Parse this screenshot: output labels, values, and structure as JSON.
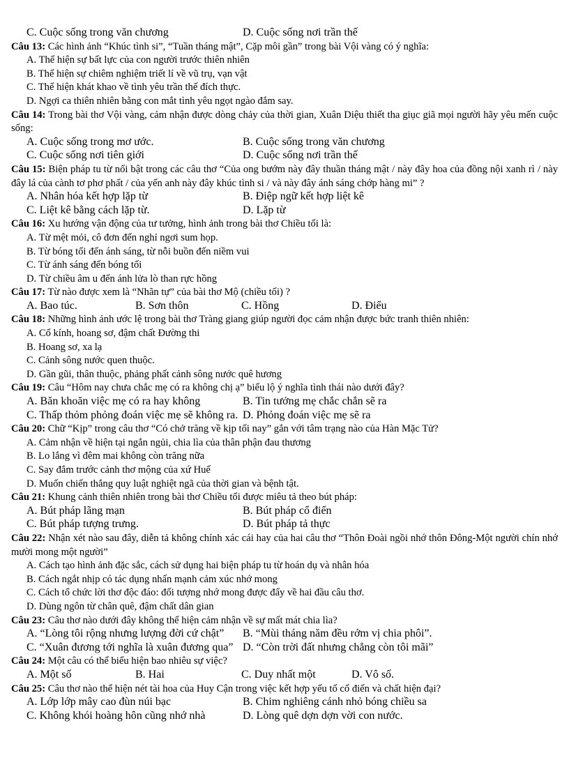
{
  "document": {
    "type": "multiple-choice-exam",
    "language": "vi",
    "subject_hint": "Ngữ văn"
  },
  "orphan_line": {
    "option_c": "C. Cuộc sống trong văn chương",
    "option_d": "D. Cuộc sống nơi trần thế"
  },
  "questions": [
    {
      "id": "cau-13",
      "number": "Câu 13:",
      "stem": " Các hình ảnh “Khúc tình si”, “Tuần tháng mật”, Cặp môi gần” trong bài Vội vàng có ý nghĩa:",
      "layout": "single",
      "options": [
        "A. Thể hiện sự bất lực của con người trước thiên nhiên",
        "B. Thể hiện sự chiêm nghiệm  triết lí về vũ trụ, vạn vật",
        "C. Thể hiện khát khao về tình yêu trần thế đích thực.",
        "D. Ngợi ca thiên nhiên bằng con mắt tình yêu ngọt ngào đắm say."
      ]
    },
    {
      "id": "cau-14",
      "number": "Câu 14:",
      "stem": " Trong bài thơ Vội vàng, cảm nhận được dòng chảy của thời gian, Xuân Diệu thiết tha giục giã mọi người hãy yêu mến cuộc sống:",
      "layout": "two-col",
      "options": [
        "A. Cuộc sống trong mơ ước.",
        "B. Cuộc sống trong văn chương",
        "C. Cuộc sống nơi tiên giới",
        "D. Cuộc sống nơi trần thế"
      ]
    },
    {
      "id": "cau-15",
      "number": "Câu 15:",
      "stem": " Biện pháp tu từ nổi bật trong các câu thơ “Của ong bướm này đây thuần tháng mật / này đây hoa của đồng nội xanh rì / này đây lá của cành tơ phơ phất / của yến anh này đây khúc tình si / và này đây ánh sáng chớp hàng mi” ?",
      "layout": "two-col",
      "options": [
        "A. Nhân hóa kết hợp lặp từ",
        "B. Điệp ngữ kết hợp liệt kê",
        "C. Liệt kê bằng cách lặp từ.",
        "D. Lặp từ"
      ]
    },
    {
      "id": "cau-16",
      "number": "Câu 16:",
      "stem": " Xu hướng vận động của tư tưởng, hình ảnh trong bài thơ Chiều tối là:",
      "layout": "single",
      "options": [
        "A. Từ mệt mỏi, cô đơn đến nghỉ ngơi sum họp.",
        "B. Từ bóng tối đến ánh sáng, từ nỗi buồn đến niềm vui",
        "C. Từ ánh sáng đến bóng tối",
        "D. Từ chiều âm u đến ánh lửa lò than rực hồng"
      ]
    },
    {
      "id": "cau-17",
      "number": "Câu 17:",
      "stem": " Từ nào được xem là “Nhãn tự” của bài thơ Mộ (chiều tối) ?",
      "layout": "four-col",
      "options": [
        "A. Bao túc.",
        "B. Sơn thôn",
        "C. Hồng",
        "D. Điểu"
      ]
    },
    {
      "id": "cau-18",
      "number": "Câu 18:",
      "stem": " Những hình ảnh ước lệ trong bài thơ Tràng giang giúp người đọc cảm nhận được bức tranh thiên nhiên:",
      "layout": "single",
      "options": [
        "A. Cổ kính, hoang sơ, đậm chất Đường thi",
        "B. Hoang sơ, xa lạ",
        "C. Cảnh sông nước quen thuộc.",
        "D. Gần gũi, thân thuộc, phảng phất cảnh sông nước quê hương"
      ]
    },
    {
      "id": "cau-19",
      "number": "Câu 19:",
      "stem": " Câu “Hôm nay chưa chắc mẹ có ra không chị ạ” biểu lộ ý nghĩa tình thái nào dưới đây?",
      "layout": "two-col",
      "options": [
        "A. Băn khoăn việc mẹ có ra hay không",
        "B. Tin tưởng mẹ chắc chắn sẽ ra",
        "C. Thấp thỏm phỏng đoán việc mẹ sẽ không ra.",
        "D. Phỏng đoán việc mẹ sẽ ra"
      ]
    },
    {
      "id": "cau-20",
      "number": "Câu 20:",
      "stem": " Chữ “Kịp” trong câu thơ “Có chở trăng về kịp tối nay” gắn với tâm trạng nào của Hàn Mặc Tử?",
      "layout": "single",
      "options": [
        "A. Cảm nhận về hiện tại ngắn ngủi, chia lìa của thân phận đau thương",
        "B. Lo lắng vì đêm mai không còn trăng nữa",
        "C. Say đắm trước cảnh thơ mộng của xứ Huế",
        "D. Muốn chiến thắng quy luật nghiệt ngã của thời gian và bệnh tật."
      ]
    },
    {
      "id": "cau-21",
      "number": "Câu 21:",
      "stem": " Khung cảnh thiên nhiên trong bài thơ Chiều tối được miêu tả theo bút pháp:",
      "layout": "two-col",
      "options": [
        "A. Bút pháp lãng mạn",
        "B. Bút pháp cổ điển",
        "C. Bút pháp tượng trưng.",
        "D. Bút pháp tả thực"
      ]
    },
    {
      "id": "cau-22",
      "number": "Câu 22:",
      "stem": " Nhận xét nào sau đây, diễn tả không chính xác cái hay của hai câu thơ “Thôn Đoài ngồi nhớ thôn Đông-Một người chín nhớ mười mong một người”",
      "layout": "single",
      "options": [
        "A. Cách tạo hình ảnh đặc sắc, cách sử dụng hai biện pháp tu từ hoán dụ và nhân hóa",
        "B. Cách ngắt nhịp có tác dụng nhấn mạnh cảm xúc nhớ mong",
        "C. Cách tổ chức lời thơ độc đáo: đối tượng nhớ mong được đẩy về hai đầu câu thơ.",
        "D. Dùng ngôn từ chân quê, đậm chất dân gian"
      ]
    },
    {
      "id": "cau-23",
      "number": "Câu 23:",
      "stem": " Câu thơ nào dưới đây không thể hiện cảm nhận về sự mất mát chia lìa?",
      "layout": "two-col",
      "options": [
        "A. “Lòng tôi rộng nhưng lượng đời cứ chật”",
        "B. “Mùi tháng năm đều rớm vị chia phôi”.",
        "C. “Xuân đương tới nghĩa là xuân đương qua”",
        "D. “Còn trời đất nhưng chẳng còn tôi mãi”"
      ]
    },
    {
      "id": "cau-24",
      "number": "Câu 24:",
      "stem": " Một câu có thể biểu hiện bao nhiêu sự việc?",
      "layout": "four-col",
      "options": [
        "A. Một số",
        "B. Hai",
        "C. Duy nhất một",
        "D. Vô số."
      ]
    },
    {
      "id": "cau-25",
      "number": "Câu 25:",
      "stem": " Câu thơ nào thể hiện nét tài hoa của Huy Cận trong việc kết hợp yếu tố cổ điển và chất hiện đại?",
      "layout": "two-col",
      "options": [
        "A. Lớp lớp mây cao đùn núi bạc",
        "B. Chim nghiêng  cánh nhỏ bóng chiều sa",
        "C. Không khói hoàng hôn cũng nhớ nhà",
        "D. Lòng quê dợn dợn vời con nước."
      ]
    }
  ]
}
